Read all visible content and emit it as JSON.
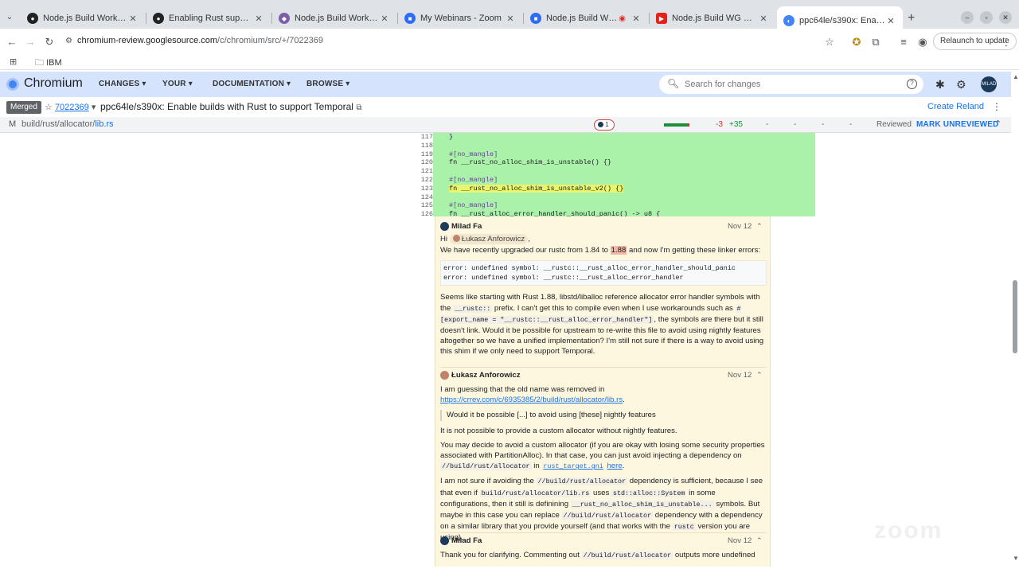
{
  "tabs": [
    {
      "label": "Node.js Build WorkGrou",
      "icon": "github-icon",
      "active": false
    },
    {
      "label": "Enabling Rust support fo",
      "icon": "github-icon",
      "active": false
    },
    {
      "label": "Node.js Build WorkGrou",
      "icon": "node-icon",
      "active": false
    },
    {
      "label": "My Webinars - Zoom",
      "icon": "zoom-icon",
      "active": false
    },
    {
      "label": "Node.js Build WG me",
      "icon": "zoom-icon",
      "active": false
    },
    {
      "label": "Node.js Build WG meetin",
      "icon": "youtube-icon",
      "active": false
    },
    {
      "label": "ppc64le/s390x: Enable b",
      "icon": "gerrit-icon",
      "active": true
    }
  ],
  "toolbar": {
    "url_host": "chromium-review.googlesource.com",
    "url_path": "/c/chromium/src/+/7022369",
    "relaunch_label": "Relaunch to update"
  },
  "bookmarks": {
    "item": "IBM"
  },
  "gerrit": {
    "title": "Chromium",
    "nav": [
      "CHANGES",
      "YOUR",
      "DOCUMENTATION",
      "BROWSE"
    ],
    "search_placeholder": "Search for changes",
    "avatar_text": "MILAD FA"
  },
  "change": {
    "status": "Merged",
    "number": "7022369",
    "title": "ppc64le/s390x: Enable builds with Rust to support Temporal",
    "reland": "Create Reland"
  },
  "file": {
    "status": "M",
    "dir": "build/rust/allocator/",
    "name": "lib.rs",
    "comment_count": "1",
    "deleted": "-3",
    "added": "+35",
    "dashes": [
      "-",
      "-",
      "-",
      "-"
    ],
    "reviewed": "Reviewed",
    "mark_unreviewed": "MARK UNREVIEWED"
  },
  "diff": {
    "lines": [
      "117",
      "118",
      "119",
      "120",
      "121",
      "122",
      "123",
      "124",
      "125",
      "126"
    ],
    "code": [
      "}",
      "",
      "#[no_mangle]",
      "fn __rust_no_alloc_shim_is_unstable() {}",
      "",
      "#[no_mangle]",
      "fn __rust_no_alloc_shim_is_unstable_v2() {}",
      "",
      "#[no_mangle]",
      "fn __rust_alloc_error_handler_should_panic() -> u8 {"
    ]
  },
  "comments": [
    {
      "author": "Milad Fa",
      "date": "Nov 12",
      "greeting": "Hi",
      "mention": "Łukasz Anforowicz",
      "greeting_end": ",",
      "line1_a": "We have recently upgraded our rustc from 1.84 to",
      "line1_hl": "1.88",
      "line1_b": "and now I'm getting these linker errors:",
      "errors": "error: undefined symbol: __rustc::__rust_alloc_error_handler_should_panic\nerror: undefined symbol: __rustc::__rust_alloc_error_handler",
      "p2_a": "Seems like starting with Rust 1.88, libstd/liballoc reference allocator error handler symbols with the",
      "p2_code1": "__rustc::",
      "p2_b": "prefix. I can't get this to compile even when I use workarounds such as",
      "p2_code2": "#[export_name = \"__rustc::__rust_alloc_error_handler\"]",
      "p2_c": ", the symbols are there but it still doesn't link. Would it be possible for upstream to re-write this file to avoid using nightly features altogether so we have a unified implementation? I'm still not sure if there is a way to avoid using this shim if we only need to support Temporal."
    },
    {
      "author": "Łukasz Anforowicz",
      "date": "Nov 12",
      "p1": "I am guessing that the old name was removed in",
      "p1_link": "https://crrev.com/c/6935385/2/build/rust/allocator/lib.rs",
      "p1_end": ".",
      "quote": "Would it be possible [...] to avoid using [these] nightly features",
      "p2": "It is not possible to provide a custom allocator without nightly features.",
      "p3_a": "You may decide to avoid a custom allocator (if you are okay with losing some security properties associated with PartitionAlloc). In that case, you can just avoid injecting a dependency on",
      "p3_code1": "//build/rust/allocator",
      "p3_in": "in",
      "p3_code2": "rust_target.gni",
      "p3_link": "here",
      "p3_end": ".",
      "p4_a": "I am not sure if avoiding the",
      "p4_code1": "//build/rust/allocator",
      "p4_b": "dependency is sufficient, because I see that even if",
      "p4_code2": "build/rust/allocator/lib.rs",
      "p4_c": "uses",
      "p4_code3": "std::alloc::System",
      "p4_d": "in some configurations, then it still is definining",
      "p4_code4": "__rust_no_alloc_shim_is_unstable...",
      "p4_e": "symbols. But maybe in this case you can replace",
      "p4_code5": "//build/rust/allocator",
      "p4_f": "dependency with a dependency on a similar library that you provide yourself (and that works with the",
      "p4_code6": "rustc",
      "p4_g": "version you are using)."
    },
    {
      "author": "Milad Fa",
      "date": "Nov 12",
      "p1_a": "Thank you for clarifying. Commenting out",
      "p1_code": "//build/rust/allocator",
      "p1_b": "outputs more undefined"
    }
  ],
  "watermark": "zoom",
  "colors": {
    "accent": "#1a73e8",
    "header_bg": "#d5e3fc",
    "diff_added": "#aaf2aa",
    "comment_bg": "#fef7e0"
  }
}
